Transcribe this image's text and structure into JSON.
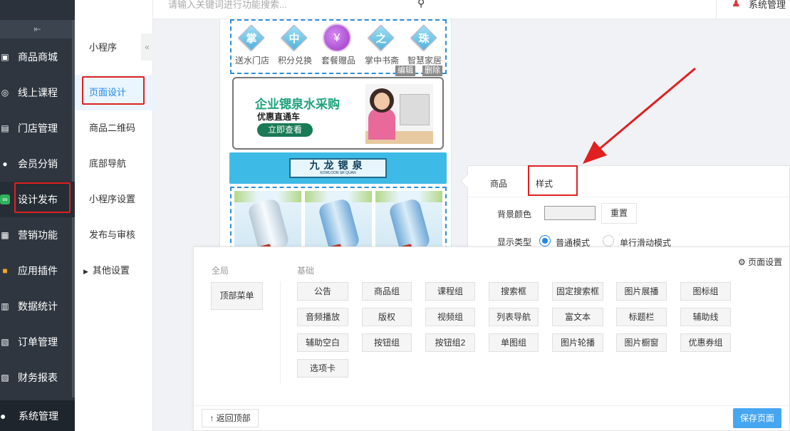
{
  "topbar": {
    "home_icon": "home-icon",
    "menu_icon": "menu-icon",
    "search_placeholder": "请输入关键词进行功能搜索...",
    "user_label": "系统管理"
  },
  "sidebar": {
    "collapse_glyph": "⇤",
    "items": [
      {
        "label": "商品商城",
        "icon": "shop-icon"
      },
      {
        "label": "线上课程",
        "icon": "course-icon"
      },
      {
        "label": "门店管理",
        "icon": "store-icon"
      },
      {
        "label": "会员分销",
        "icon": "member-icon"
      },
      {
        "label": "设计发布",
        "icon": "design-icon"
      },
      {
        "label": "营销功能",
        "icon": "marketing-icon"
      },
      {
        "label": "应用插件",
        "icon": "plugin-icon"
      },
      {
        "label": "数据统计",
        "icon": "stats-icon"
      },
      {
        "label": "订单管理",
        "icon": "order-icon"
      },
      {
        "label": "财务报表",
        "icon": "finance-icon"
      }
    ],
    "bottom_label": "系统管理"
  },
  "submenu": {
    "title": "小程序",
    "items": [
      "页面设计",
      "商品二维码",
      "底部导航",
      "小程序设置",
      "发布与审核"
    ],
    "other": "其他设置"
  },
  "preview": {
    "nav_icons": [
      {
        "char": "掌",
        "label": "送水门店"
      },
      {
        "char": "中",
        "label": "积分兑换"
      },
      {
        "char": "¥",
        "label": "套餐赠品"
      },
      {
        "char": "之",
        "label": "掌中书斋"
      },
      {
        "char": "珠",
        "label": "智慧家居"
      }
    ],
    "edit_label": "编辑",
    "delete_label": "删除",
    "banner1": {
      "title": "企业锶泉水采购",
      "subtitle": "优惠直通车",
      "button": "立即查看"
    },
    "banner2": {
      "title": "九龙锶泉",
      "subtitle": "KOWLOON SR QUAN"
    }
  },
  "settings": {
    "tab_goods": "商品",
    "tab_style": "样式",
    "bg_color_label": "背景颜色",
    "reset_label": "重置",
    "display_type_label": "显示类型",
    "mode_normal": "普通模式",
    "mode_slide": "单行滑动模式"
  },
  "components": {
    "global_title": "全局",
    "basic_title": "基础",
    "page_settings": "页面设置",
    "top_menu": "顶部菜单",
    "buttons": [
      "公告",
      "商品组",
      "课程组",
      "搜索框",
      "固定搜索框",
      "图片展播",
      "图标组",
      "音频播放",
      "版权",
      "视频组",
      "列表导航",
      "富文本",
      "标题栏",
      "辅助线",
      "辅助空白",
      "按钮组",
      "按钮组2",
      "单图组",
      "图片轮播",
      "图片橱窗",
      "优惠券组",
      "选项卡"
    ],
    "back_to_top": "返回顶部",
    "save_page": "保存页面"
  },
  "colors": {
    "sidebar_bg": "#2f3640",
    "highlight_red": "#e02020",
    "primary_blue": "#1e88e5",
    "save_button": "#46a6f0"
  }
}
